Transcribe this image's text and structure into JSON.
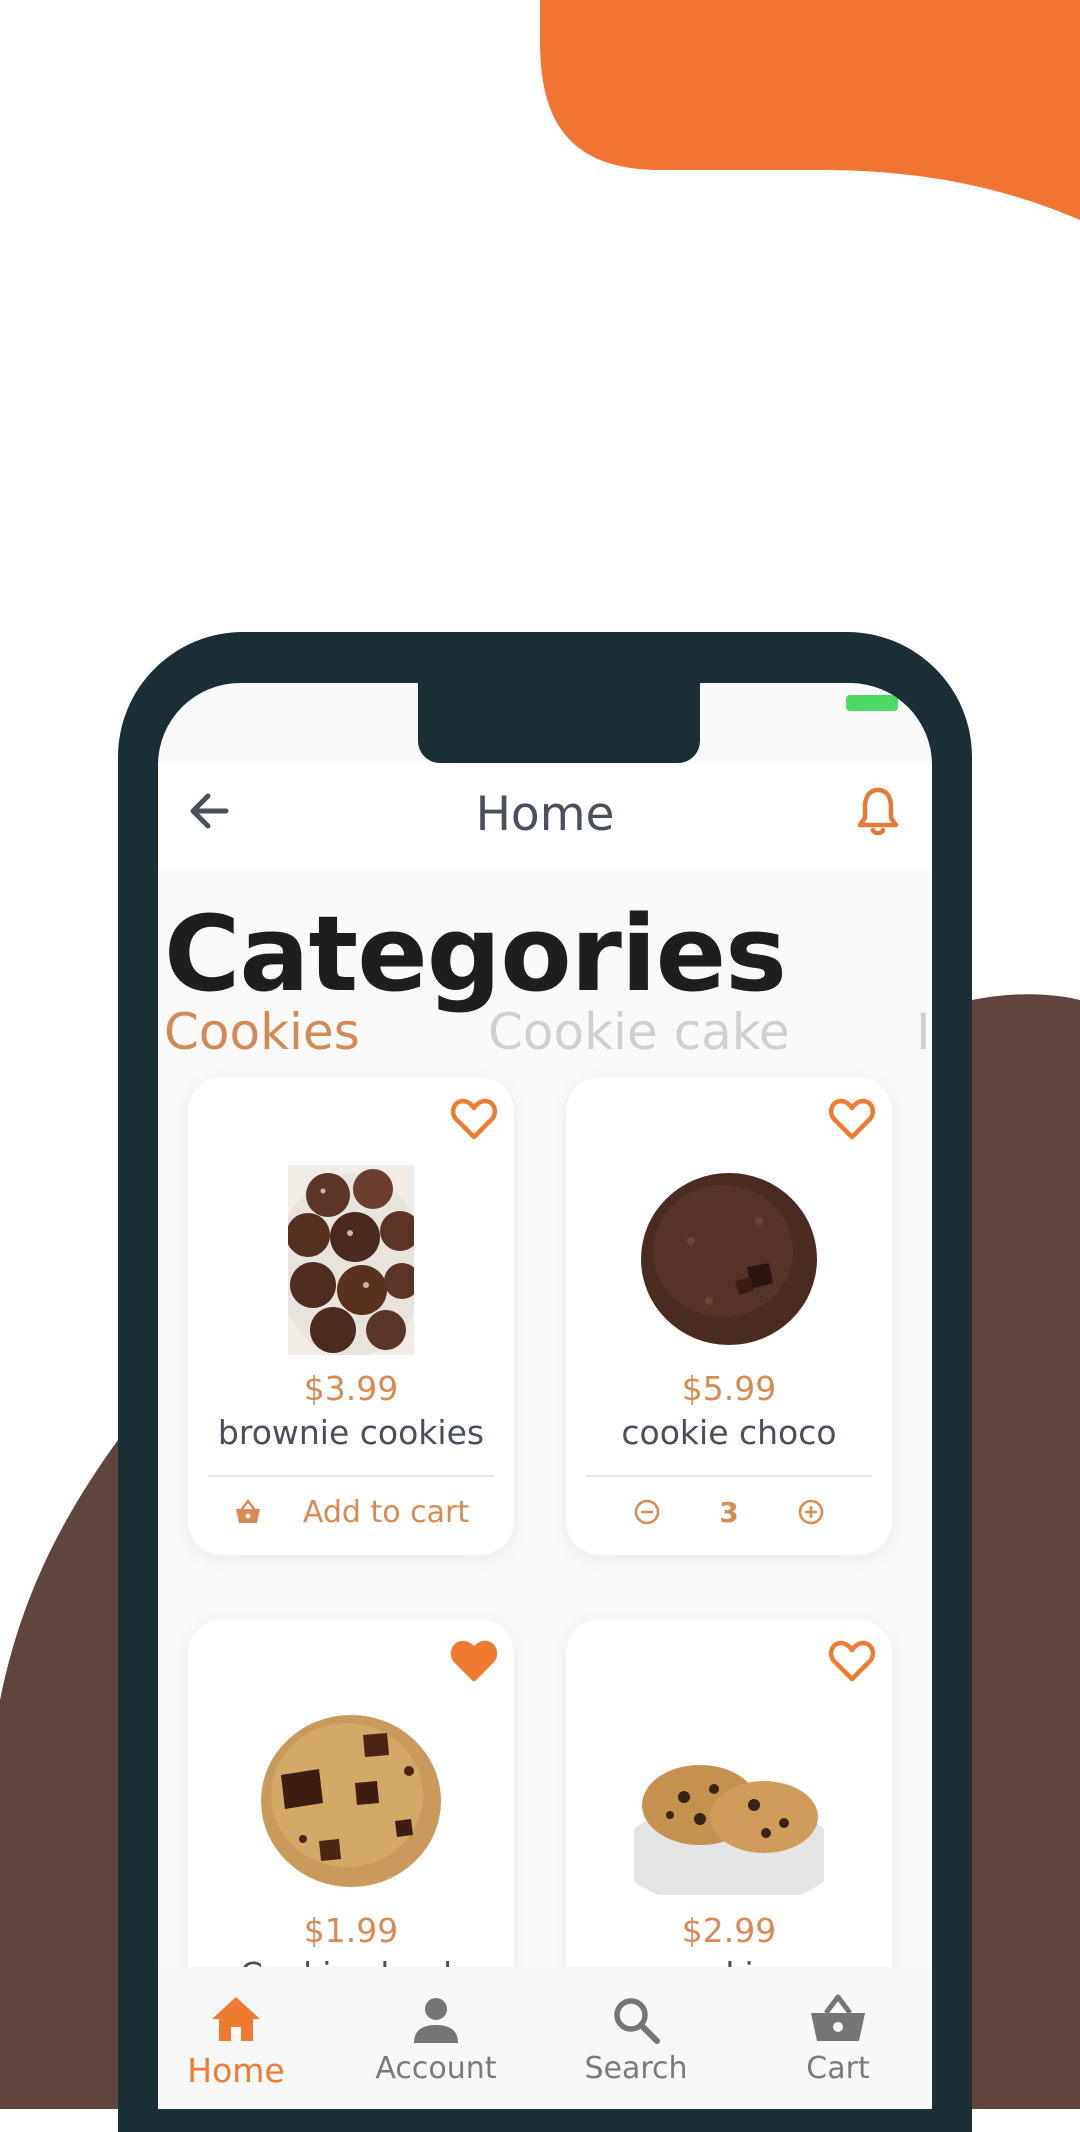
{
  "colors": {
    "accent": "#f07a30",
    "brown": "#5f453d",
    "frame": "#1b2e35",
    "price": "#d98a52"
  },
  "appbar": {
    "title": "Home",
    "back_icon": "arrow-left-icon",
    "bell_icon": "bell-icon"
  },
  "categories": {
    "title": "Categories",
    "tabs": [
      {
        "label": "Cookies",
        "active": true
      },
      {
        "label": "Cookie cake",
        "active": false
      },
      {
        "label": "Ic",
        "active": false
      }
    ]
  },
  "products": [
    {
      "price": "$3.99",
      "name": "brownie cookies",
      "favorite": false,
      "action": "Add to cart"
    },
    {
      "price": "$5.99",
      "name": "cookie choco",
      "favorite": false,
      "quantity": "3"
    },
    {
      "price": "$1.99",
      "name": "Cookie chunk",
      "favorite": true
    },
    {
      "price": "$2.99",
      "name": "cookies",
      "favorite": false
    }
  ],
  "bottom_nav": [
    {
      "label": "Home",
      "icon": "home-icon",
      "active": true
    },
    {
      "label": "Account",
      "icon": "person-icon",
      "active": false
    },
    {
      "label": "Search",
      "icon": "search-icon",
      "active": false
    },
    {
      "label": "Cart",
      "icon": "basket-icon",
      "active": false
    }
  ]
}
